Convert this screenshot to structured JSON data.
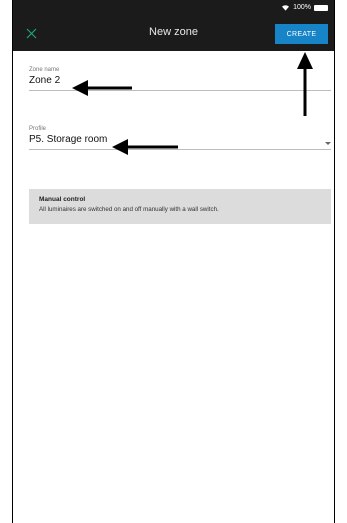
{
  "status_bar": {
    "signal": "100%"
  },
  "app_bar": {
    "title": "New zone",
    "create_label": "CREATE"
  },
  "zone_name": {
    "label": "Zone name",
    "value": "Zone 2"
  },
  "profile": {
    "label": "Profile",
    "value": "P5. Storage room"
  },
  "info": {
    "title": "Manual control",
    "text": "All luminaires are switched on and off manually with a wall switch."
  },
  "colors": {
    "toolbar": "#1b1b1b",
    "accent": "#1784c8",
    "close": "#1fa37a",
    "info_bg": "#dcdcdc"
  },
  "icons": {
    "close": "close-icon",
    "wifi": "wifi-icon",
    "battery": "battery-icon",
    "dropdown": "chevron-down-icon"
  }
}
